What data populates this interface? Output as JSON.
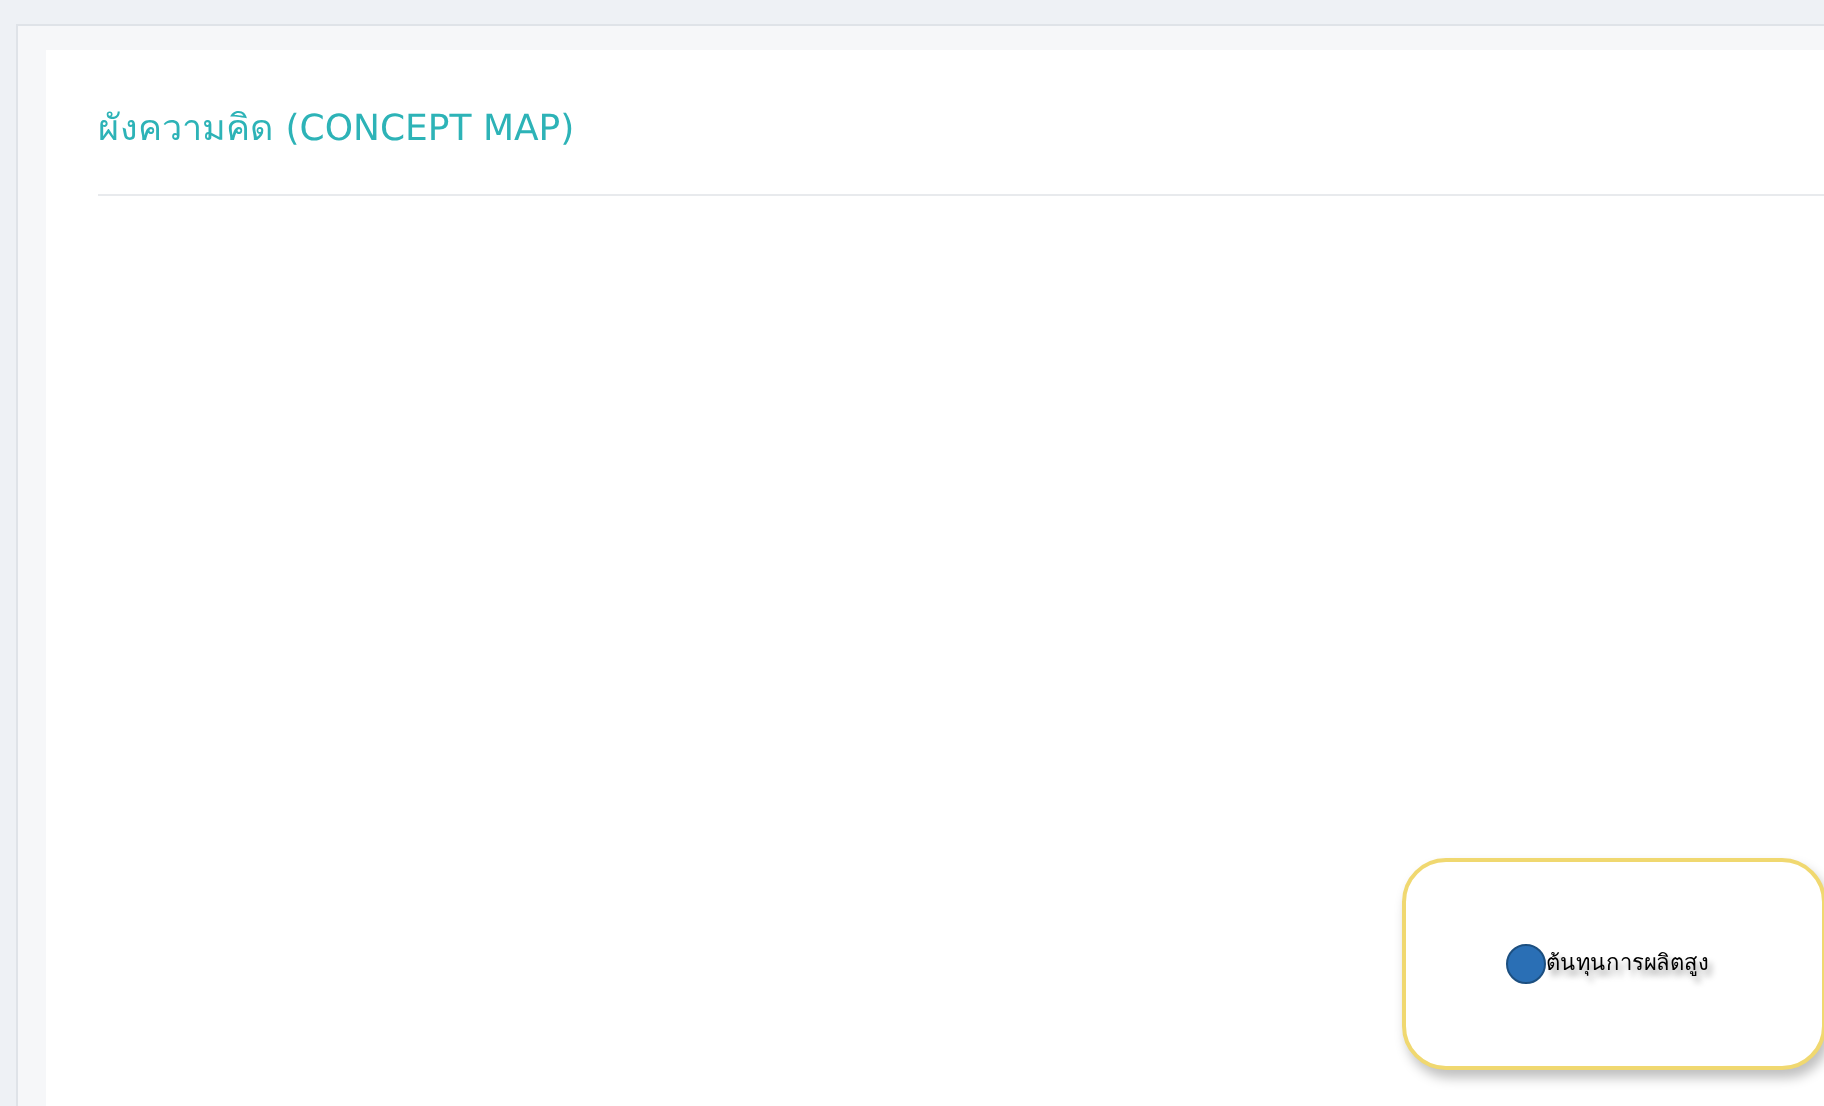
{
  "panel": {
    "title": "ผังความคิด (CONCEPT MAP)"
  },
  "concept_map": {
    "nodes": [
      {
        "label": "ต้นทุนการผลิตสูง",
        "color": "#2a6fb5"
      }
    ]
  }
}
